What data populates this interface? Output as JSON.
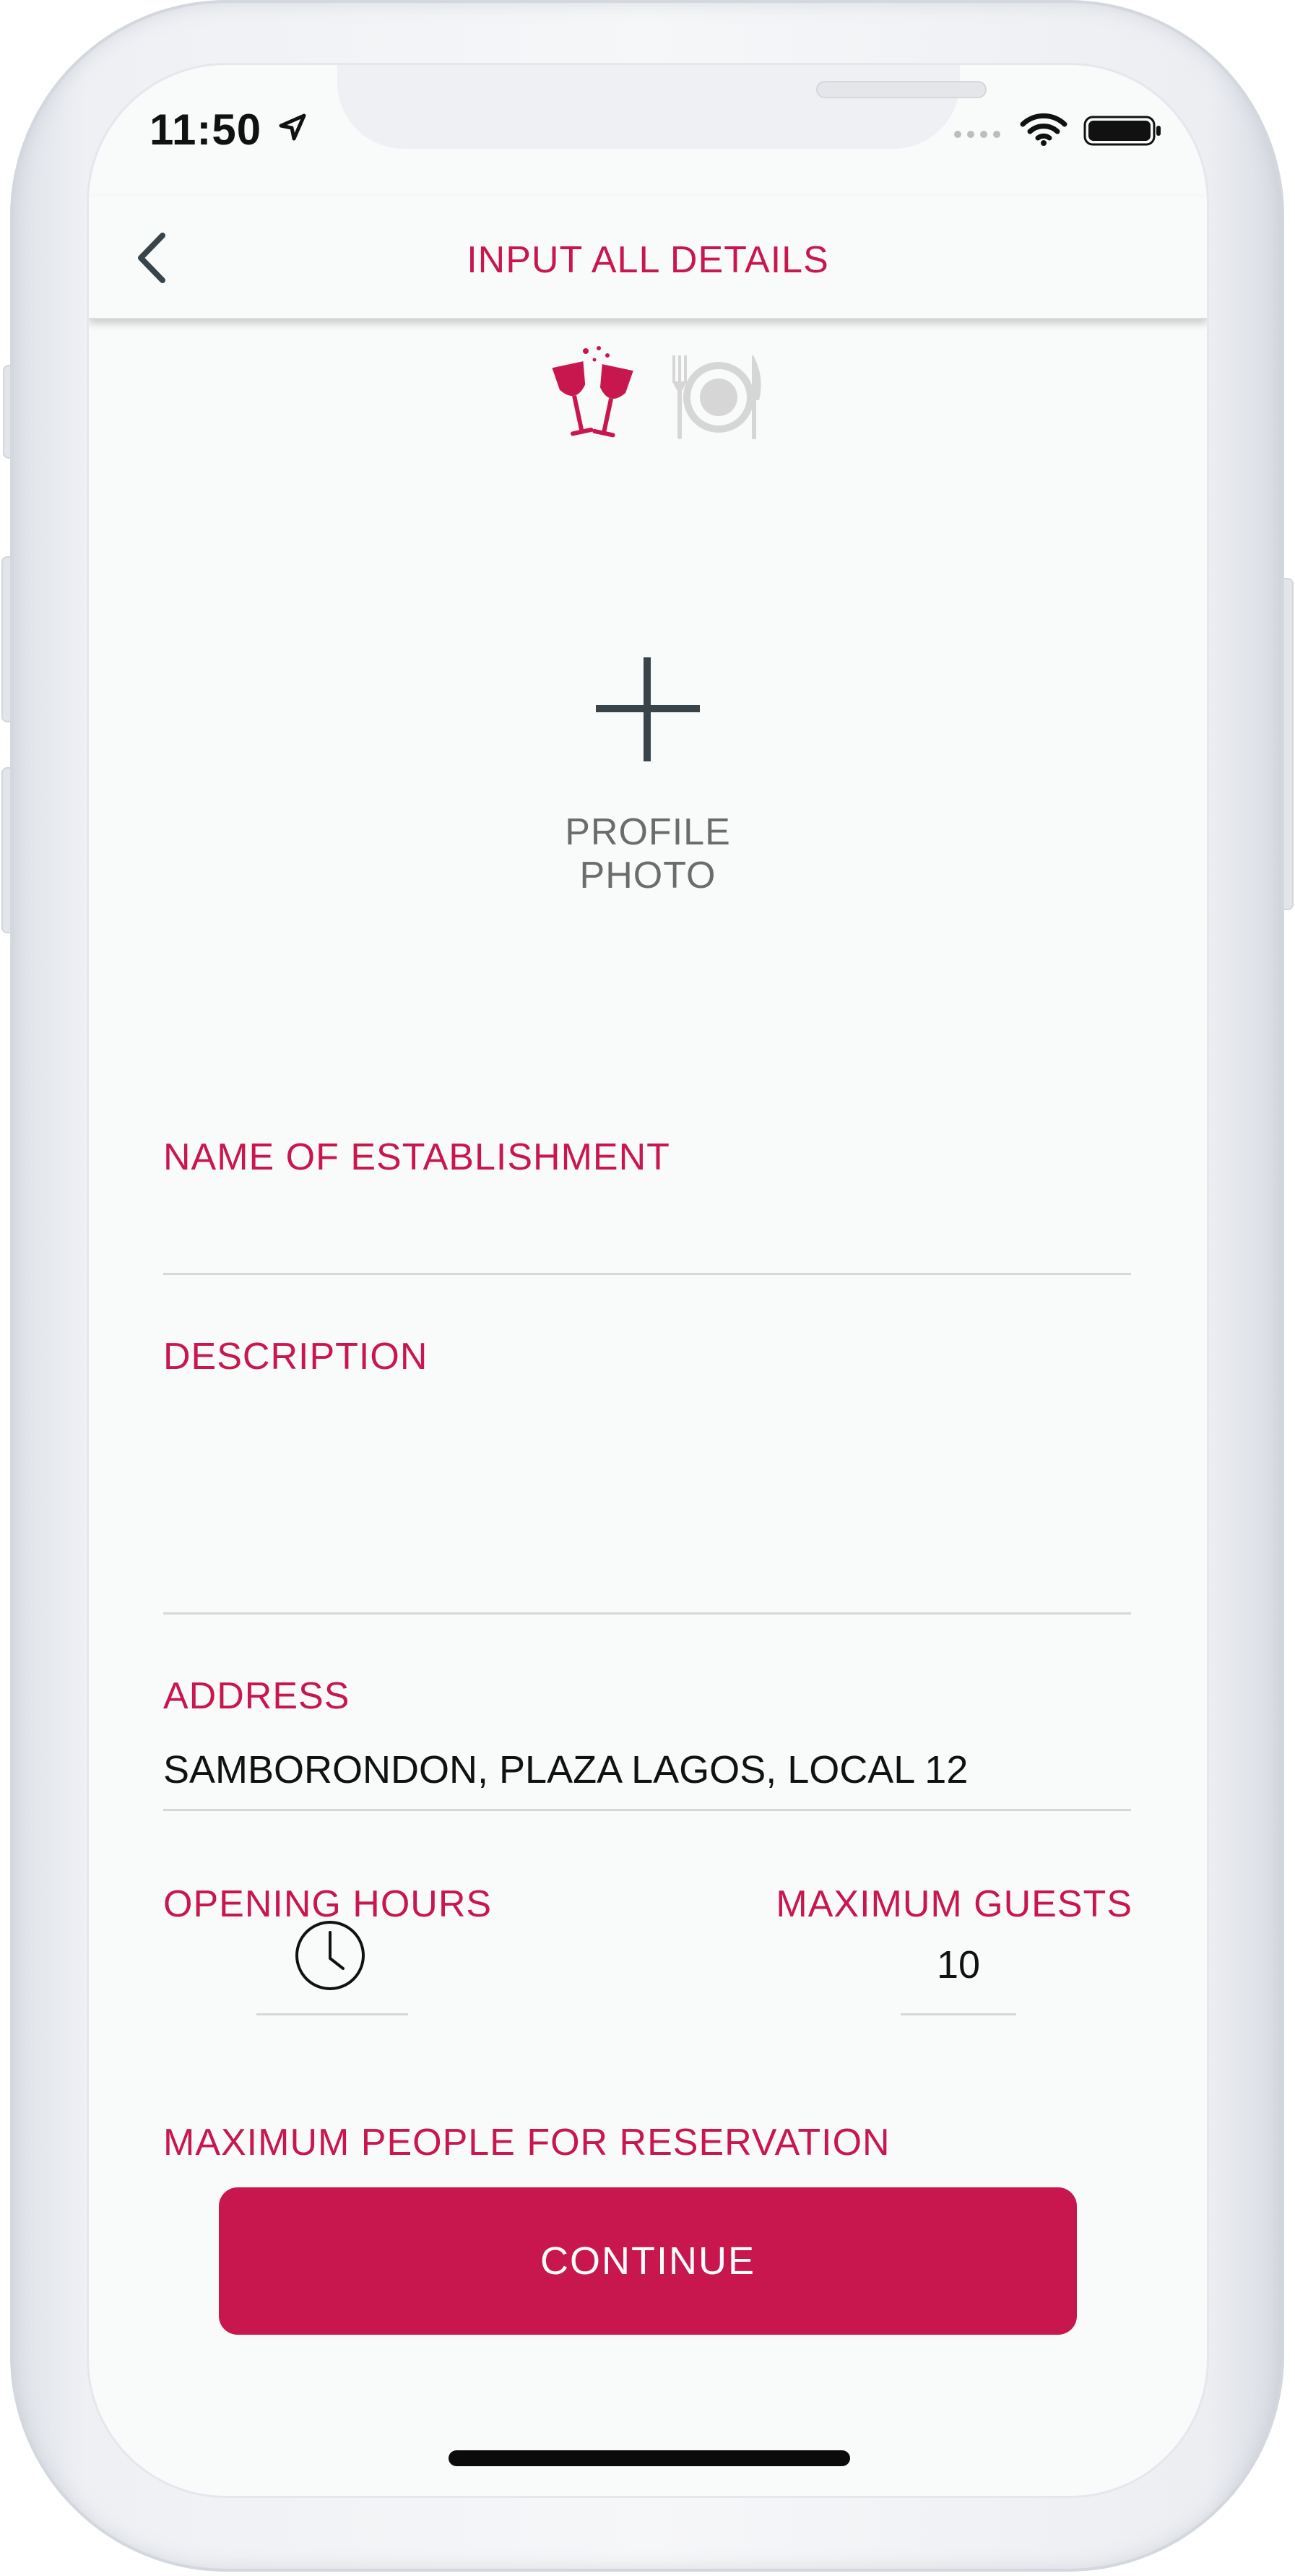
{
  "status_bar": {
    "time": "11:50",
    "icons": [
      "location-arrow-icon",
      "signal-dots-icon",
      "wifi-icon",
      "battery-icon"
    ]
  },
  "header": {
    "title": "INPUT ALL DETAILS",
    "back_icon": "chevron-left-icon"
  },
  "categories": [
    {
      "icon": "wine-glasses-icon",
      "state": "selected",
      "color": "#c8174f"
    },
    {
      "icon": "plate-cutlery-icon",
      "state": "unselected",
      "color": "#d6d6d6"
    }
  ],
  "profile_photo": {
    "icon": "plus-icon",
    "label": "PROFILE PHOTO"
  },
  "form": {
    "name": {
      "label": "NAME OF ESTABLISHMENT",
      "value": ""
    },
    "description": {
      "label": "DESCRIPTION",
      "value": ""
    },
    "address": {
      "label": "ADDRESS",
      "value": "SAMBORONDON, PLAZA LAGOS, LOCAL 12"
    },
    "opening_hours": {
      "label": "OPENING HOURS",
      "icon": "clock-icon"
    },
    "max_guests": {
      "label": "MAXIMUM GUESTS",
      "value": "10"
    },
    "max_people": {
      "label": "MAXIMUM PEOPLE FOR RESERVATION"
    }
  },
  "continue_label": "CONTINUE",
  "colors": {
    "accent": "#c8174f",
    "background": "#f9fafa",
    "divider": "#d7d7d7",
    "secondary_text": "#6c6c6c"
  }
}
